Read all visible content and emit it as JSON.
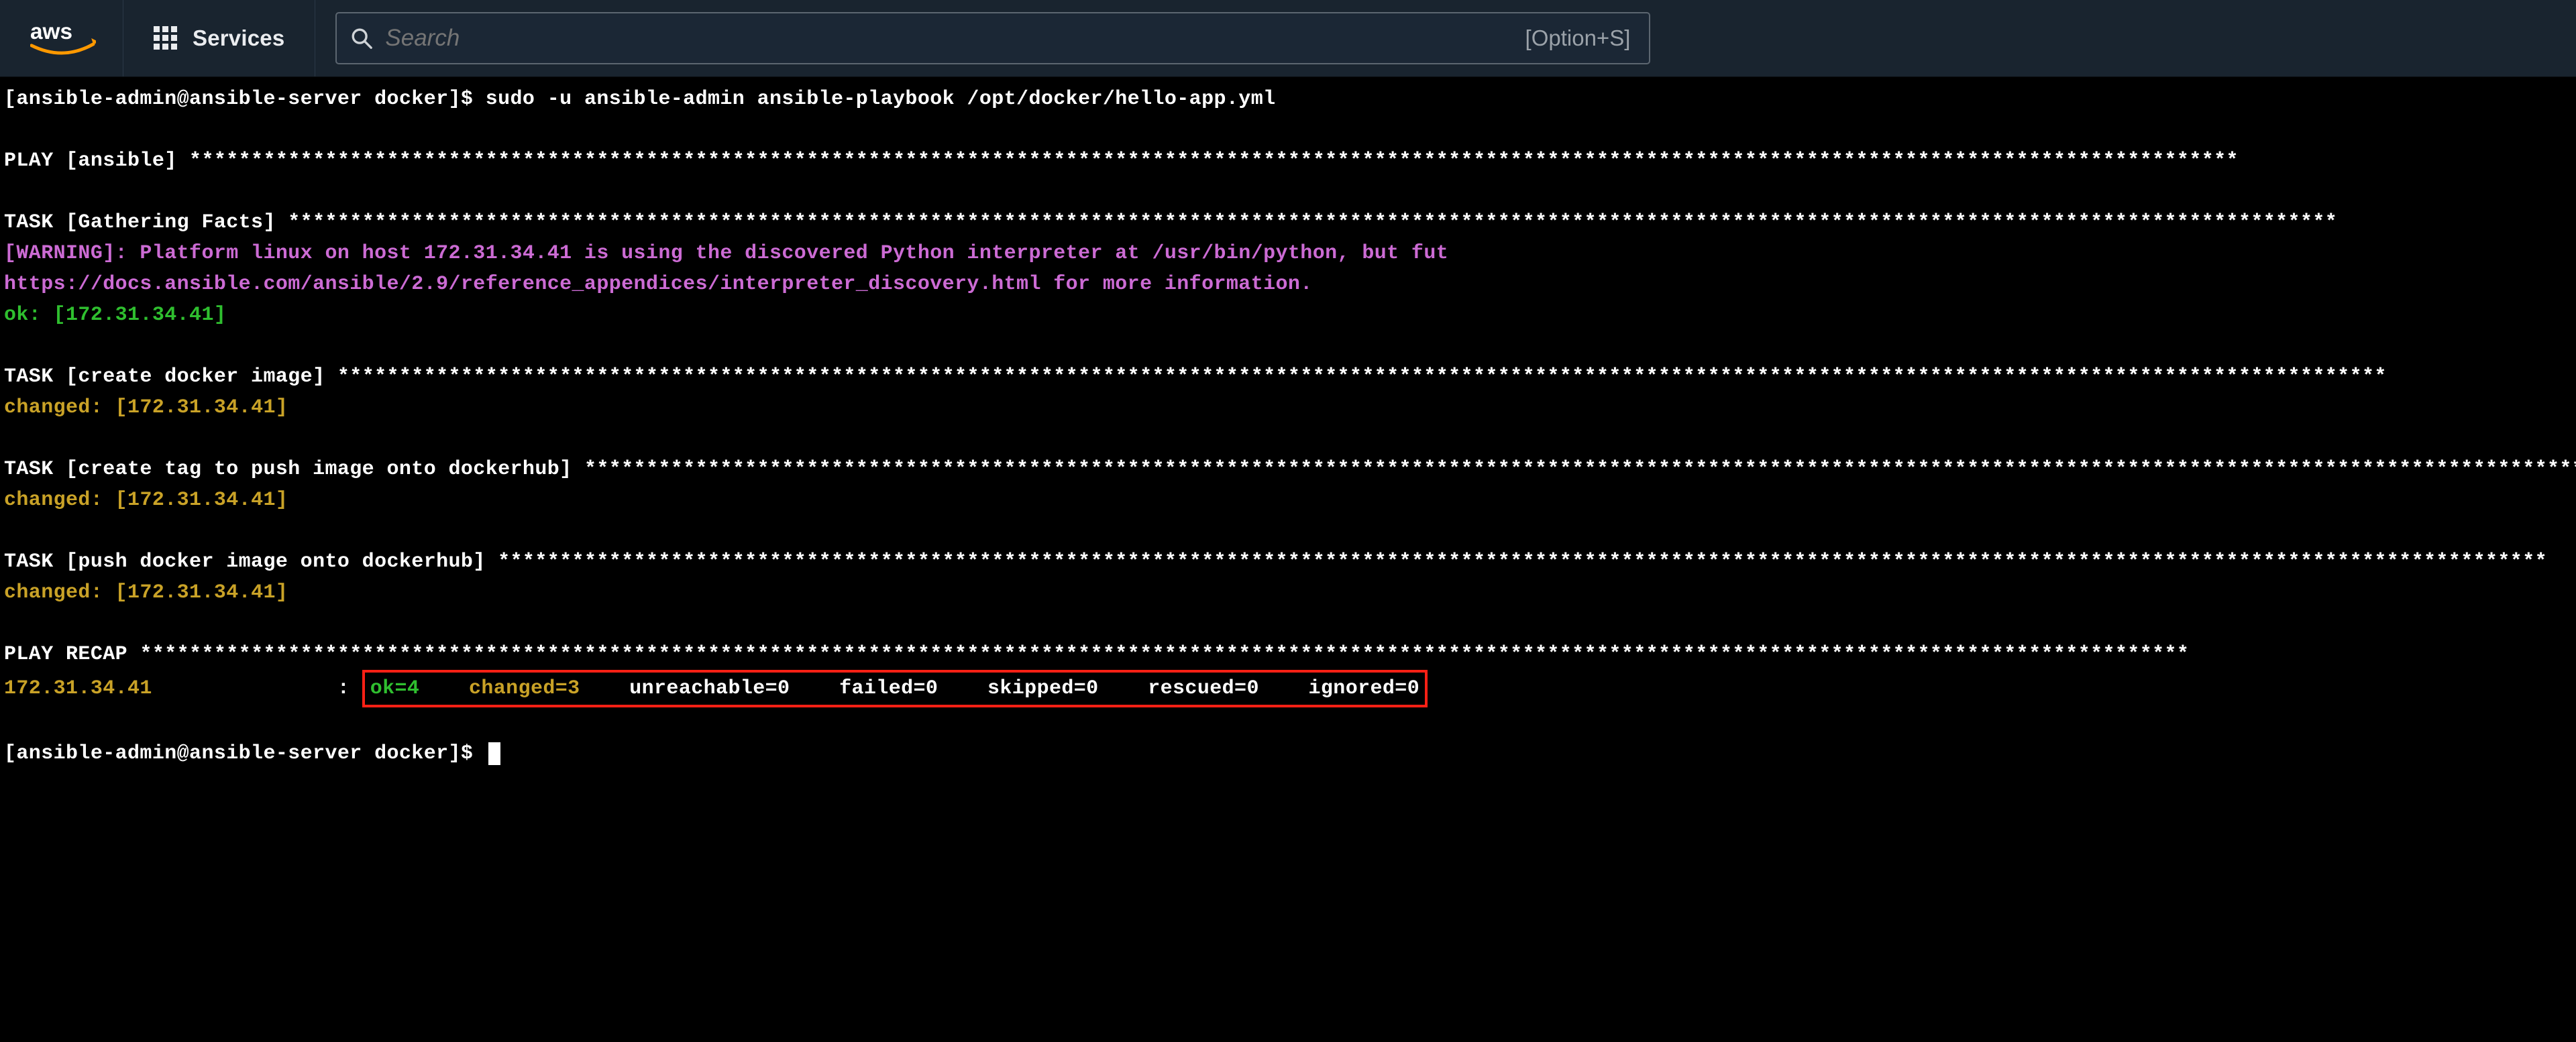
{
  "header": {
    "logo_text": "aws",
    "services_label": "Services",
    "search_placeholder": "Search",
    "search_shortcut": "[Option+S]"
  },
  "terminal": {
    "prompt1_user_host": "[ansible-admin@ansible-server docker]$",
    "prompt1_command": "sudo -u ansible-admin ansible-playbook /opt/docker/hello-app.yml",
    "play_header_prefix": "PLAY [ansible] ",
    "task1_prefix": "TASK [Gathering Facts] ",
    "warning_line": "[WARNING]: Platform linux on host 172.31.34.41 is using the discovered Python interpreter at /usr/bin/python, but fut",
    "docs_line": "https://docs.ansible.com/ansible/2.9/reference_appendices/interpreter_discovery.html for more information.",
    "ok_line_prefix": "ok: ",
    "ok_line_host": "[172.31.34.41]",
    "task2_prefix": "TASK [create docker image] ",
    "changed_prefix": "changed: ",
    "changed_host": "[172.31.34.41]",
    "task3_prefix": "TASK [create tag to push image onto dockerhub] ",
    "task4_prefix": "TASK [push docker image onto dockerhub] ",
    "recap_prefix": "PLAY RECAP ",
    "recap_host": "172.31.34.41",
    "recap_colon_spacer": "               : ",
    "recap_ok": "ok=4",
    "recap_changed": "changed=3",
    "recap_unreachable": "unreachable=0",
    "recap_failed": "failed=0",
    "recap_skipped": "skipped=0",
    "recap_rescued": "rescued=0",
    "recap_ignored": "ignored=0",
    "prompt2_user_host": "[ansible-admin@ansible-server docker]$"
  },
  "chart_data": {
    "type": "table",
    "title": "PLAY RECAP",
    "categories": [
      "ok",
      "changed",
      "unreachable",
      "failed",
      "skipped",
      "rescued",
      "ignored"
    ],
    "series": [
      {
        "name": "172.31.34.41",
        "values": [
          4,
          3,
          0,
          0,
          0,
          0,
          0
        ]
      }
    ]
  }
}
